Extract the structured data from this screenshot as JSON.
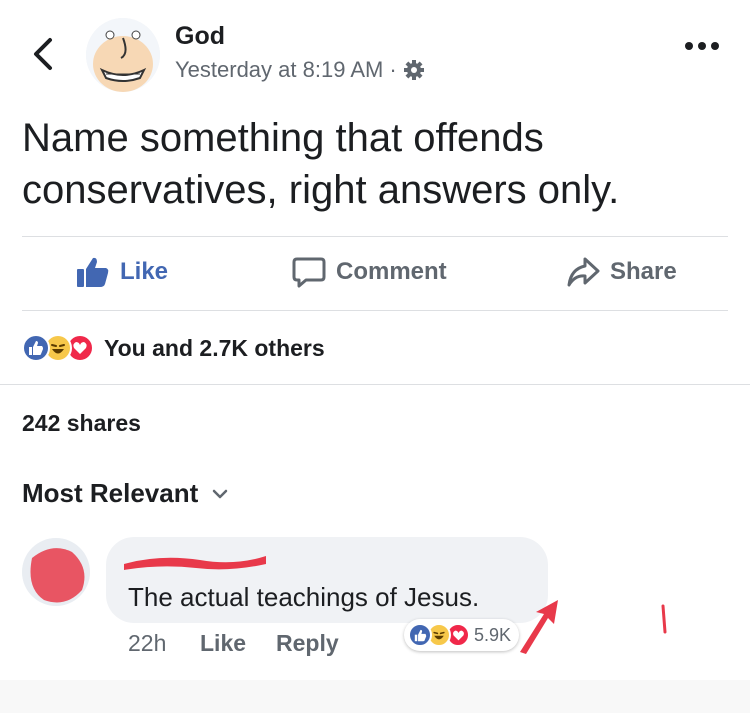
{
  "header": {
    "author": "God",
    "timestamp": "Yesterday at 8:19 AM",
    "separator": "·",
    "privacy_icon": "gear-icon",
    "back_icon": "chevron-left-icon",
    "more_icon": "more-horizontal-icon"
  },
  "post": {
    "text": "Name something that offends conservatives, right answers only."
  },
  "actions": {
    "like": "Like",
    "comment": "Comment",
    "share": "Share"
  },
  "reactions": {
    "icons": [
      "like-reaction-icon",
      "haha-reaction-icon",
      "love-reaction-icon"
    ],
    "summary": "You and 2.7K others"
  },
  "shares": "242 shares",
  "comments": {
    "sort_label": "Most Relevant",
    "items": [
      {
        "text": "The actual teachings of Jesus.",
        "time": "22h",
        "like": "Like",
        "reply": "Reply",
        "reaction_count": "5.9K"
      }
    ]
  },
  "colors": {
    "link_blue": "#4267b2",
    "muted": "#60676f",
    "love_red": "#f0284a",
    "haha_yellow": "#f7c84a",
    "redaction": "#e8394a"
  }
}
